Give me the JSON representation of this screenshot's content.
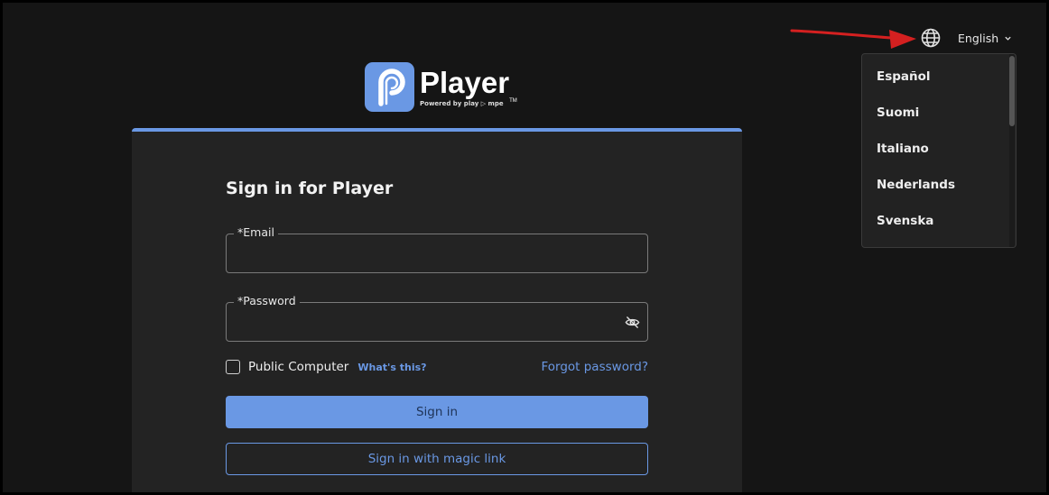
{
  "header": {
    "language_current": "English",
    "language_options": [
      "Español",
      "Suomi",
      "Italiano",
      "Nederlands",
      "Svenska"
    ]
  },
  "logo": {
    "title": "Player",
    "trademark": "TM",
    "subtitle": "Powered by play ▷ mpe"
  },
  "signin": {
    "title": "Sign in for Player",
    "email_label": "*Email",
    "password_label": "*Password",
    "public_computer_label": "Public Computer",
    "whats_this": "What's this?",
    "forgot_password": "Forgot password?",
    "sign_in_button": "Sign in",
    "magic_link_button": "Sign in with magic link"
  },
  "colors": {
    "accent": "#6a98e4",
    "background": "#151515",
    "card": "#232323",
    "annotation_arrow": "#d42020"
  }
}
